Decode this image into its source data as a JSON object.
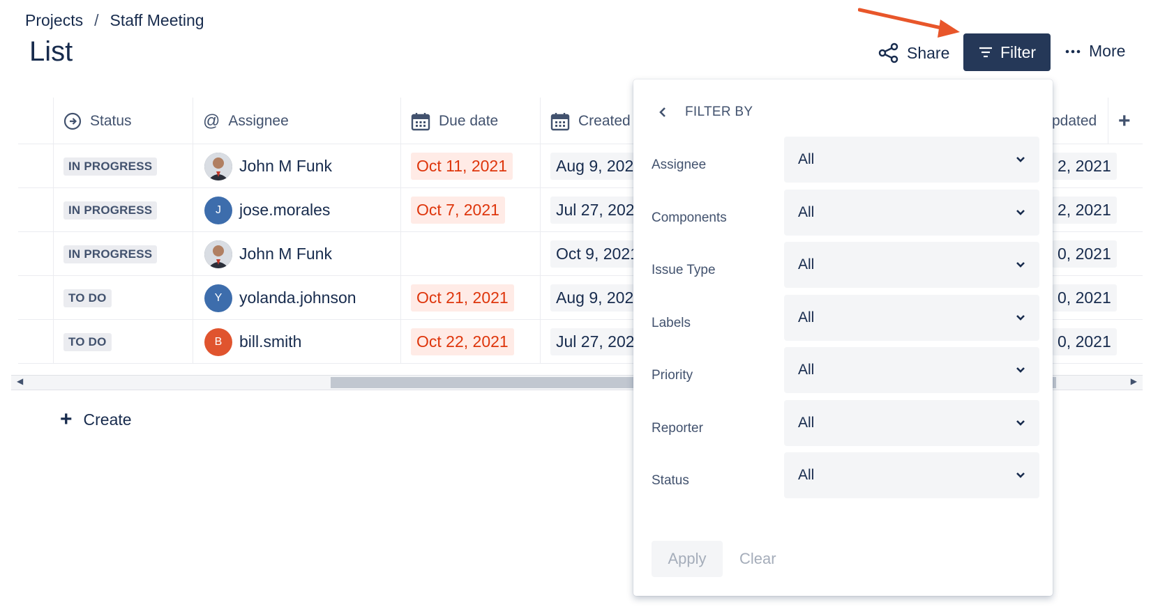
{
  "breadcrumb": {
    "projects": "Projects",
    "separator": "/",
    "current": "Staff Meeting"
  },
  "page_title": "List",
  "actions": {
    "share": "Share",
    "filter": "Filter",
    "more": "More"
  },
  "columns": {
    "status": "Status",
    "assignee": "Assignee",
    "due_date": "Due date",
    "created": "Created",
    "updated": "pdated"
  },
  "rows": [
    {
      "status": "IN PROGRESS",
      "assignee": "John M Funk",
      "avatar": "photo",
      "due": "Oct 11, 2021",
      "created": "Aug 9, 202",
      "updated": "2, 2021"
    },
    {
      "status": "IN PROGRESS",
      "assignee": "jose.morales",
      "avatar": "J",
      "due": "Oct 7, 2021",
      "created": "Jul 27, 202",
      "updated": "2, 2021"
    },
    {
      "status": "IN PROGRESS",
      "assignee": "John M Funk",
      "avatar": "photo",
      "due": "",
      "created": "Oct 9, 2021",
      "updated": "0, 2021"
    },
    {
      "status": "TO DO",
      "assignee": "yolanda.johnson",
      "avatar": "Y",
      "due": "Oct 21, 2021",
      "created": "Aug 9, 202",
      "updated": "0, 2021"
    },
    {
      "status": "TO DO",
      "assignee": "bill.smith",
      "avatar": "B",
      "due": "Oct 22, 2021",
      "created": "Jul 27, 202",
      "updated": "0, 2021"
    }
  ],
  "create": "Create",
  "filter_panel": {
    "title": "FILTER BY",
    "fields": [
      {
        "label": "Assignee",
        "value": "All"
      },
      {
        "label": "Components",
        "value": "All"
      },
      {
        "label": "Issue Type",
        "value": "All"
      },
      {
        "label": "Labels",
        "value": "All"
      },
      {
        "label": "Priority",
        "value": "All"
      },
      {
        "label": "Reporter",
        "value": "All"
      },
      {
        "label": "Status",
        "value": "All"
      }
    ],
    "apply": "Apply",
    "clear": "Clear"
  },
  "colors": {
    "primary_dark": "#253858",
    "overdue": "#de350b",
    "overdue_bg": "#ffebe6",
    "annotation_arrow": "#e8562a"
  }
}
